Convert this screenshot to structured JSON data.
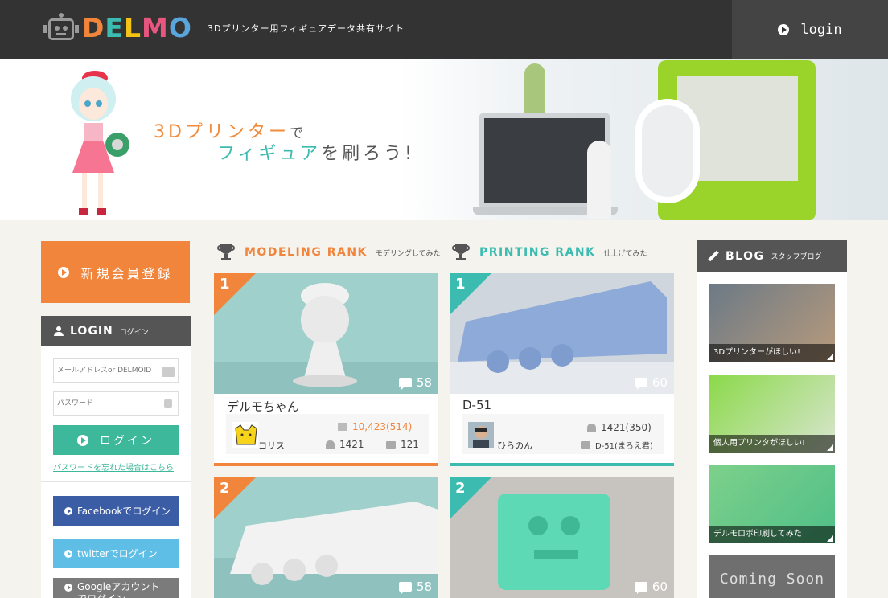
{
  "header": {
    "logo_text": "DELMO",
    "logo_colors": [
      "#f0853b",
      "#3cbcb0",
      "#f3c316",
      "#e8557e",
      "#58a6db"
    ],
    "tagline": "3Dプリンター用フィギュアデータ共有サイト",
    "login_label": "login"
  },
  "hero": {
    "line1_accent": "3Dプリンター",
    "line1_rest": "で",
    "line2_accent": "フィギュア",
    "line2_rest": "を刷ろう!"
  },
  "sidebar": {
    "register_label": "新規会員登録",
    "login_title": "LOGIN",
    "login_subtitle": "ログイン",
    "email_placeholder": "メールアドレスor DELMOID",
    "password_placeholder": "パスワード",
    "login_button": "ログイン",
    "forgot_link": "パスワードを忘れた場合はこちら",
    "facebook_label": "Facebookでログイン",
    "twitter_label": "twitterでログイン",
    "google_label": "Googleアカウントでログイン",
    "colors": {
      "register": "#f0853b",
      "login": "#3eb89a",
      "facebook": "#3b5da5",
      "twitter": "#5fbee6"
    }
  },
  "modeling_rank": {
    "title": "MODELING RANK",
    "subtitle": "モデリングしてみた",
    "accent": "#f0853b",
    "items": [
      {
        "rank": "1",
        "comments": "58",
        "title": "デルモちゃん",
        "user": "コリス",
        "downloads": "10,423(514)",
        "likes": "1421",
        "prints": "121"
      },
      {
        "rank": "2",
        "comments": "58"
      }
    ]
  },
  "printing_rank": {
    "title": "PRINTING RANK",
    "subtitle": "仕上げてみた",
    "accent": "#3cbcb0",
    "items": [
      {
        "rank": "1",
        "comments": "60",
        "title": "D-51",
        "user": "ひらのん",
        "likes": "1421(350)",
        "source": "D-51(まろえ君)"
      },
      {
        "rank": "2",
        "comments": "60"
      }
    ]
  },
  "blog": {
    "title": "BLOG",
    "subtitle": "スタッフブログ",
    "items": [
      {
        "caption": "3Dプリンターがほしい!"
      },
      {
        "caption": "個人用プリンタがほしい!"
      },
      {
        "caption": "デルモロボ印刷してみた"
      }
    ],
    "coming_soon": "Coming Soon"
  }
}
